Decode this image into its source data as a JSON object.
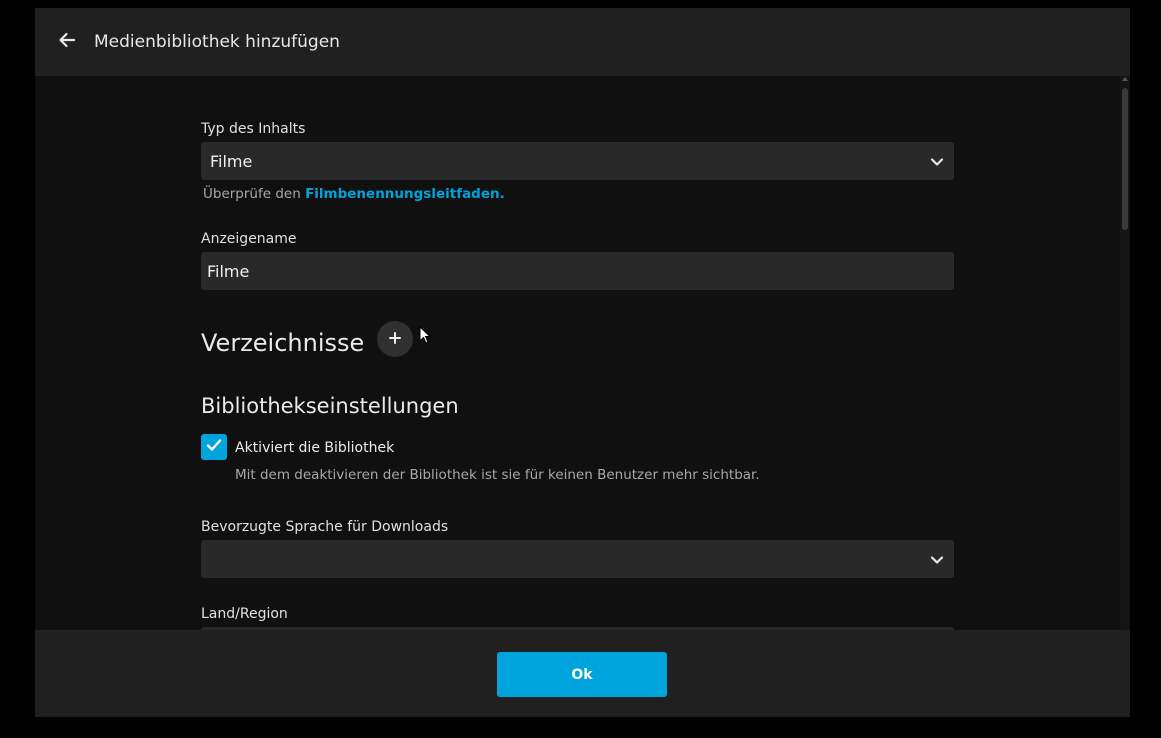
{
  "header": {
    "title": "Medienbibliothek hinzufügen",
    "back_icon": "arrow-left-icon"
  },
  "content_type": {
    "label": "Typ des Inhalts",
    "value": "Filme",
    "hint_prefix": "Überprüfe den ",
    "hint_link": "Filmbenennungsleitfaden."
  },
  "display_name": {
    "label": "Anzeigename",
    "value": "Filme"
  },
  "folders": {
    "title": "Verzeichnisse",
    "add_icon": "plus-icon"
  },
  "library_settings": {
    "title": "Bibliothekseinstellungen",
    "enable_library": {
      "checked": true,
      "label": "Aktiviert die Bibliothek",
      "description": "Mit dem deaktivieren der Bibliothek ist sie für keinen Benutzer mehr sichtbar."
    },
    "preferred_language": {
      "label": "Bevorzugte Sprache für Downloads",
      "value": ""
    },
    "country_region": {
      "label": "Land/Region",
      "value": ""
    }
  },
  "footer": {
    "ok_label": "Ok"
  },
  "colors": {
    "accent": "#00a4dc",
    "background": "#101010",
    "header": "#202020",
    "field": "#292929"
  }
}
